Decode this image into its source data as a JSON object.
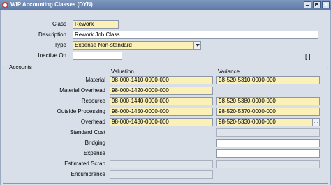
{
  "window": {
    "title": "WIP Accounting Classes (DYN)"
  },
  "header": {
    "class_label": "Class",
    "class_value": "Rework",
    "description_label": "Description",
    "description_value": "Rework Job Class",
    "type_label": "Type",
    "type_value": "Expense Non-standard",
    "inactive_label": "Inactive On",
    "inactive_value": "",
    "bracket_text": "[ ]"
  },
  "accounts": {
    "title": "Accounts",
    "valuation_header": "Valuation",
    "variance_header": "Variance",
    "rows": [
      {
        "label": "Material",
        "valuation": "98-000-1410-0000-000",
        "variance": "98-520-5310-0000-000"
      },
      {
        "label": "Material Overhead",
        "valuation": "98-000-1420-0000-000",
        "variance": ""
      },
      {
        "label": "Resource",
        "valuation": "98-000-1440-0000-000",
        "variance": "98-520-5380-0000-000"
      },
      {
        "label": "Outside Processing",
        "valuation": "98-000-1450-0000-000",
        "variance": "98-520-5370-0000-000"
      },
      {
        "label": "Overhead",
        "valuation": "98-000-1430-0000-000",
        "variance": "98-520-5330-0000-000"
      },
      {
        "label": "Standard Cost",
        "valuation": "",
        "variance": ""
      },
      {
        "label": "Bridging",
        "valuation": "",
        "variance": ""
      },
      {
        "label": "Expense",
        "valuation": "",
        "variance": ""
      },
      {
        "label": "Estimated Scrap",
        "valuation": "",
        "variance": ""
      },
      {
        "label": "Encumbrance",
        "valuation": "",
        "variance": ""
      }
    ]
  },
  "colors": {
    "required": "#fbf0b6",
    "titlebar": "#6b86b2",
    "background": "#d8dfe8"
  }
}
